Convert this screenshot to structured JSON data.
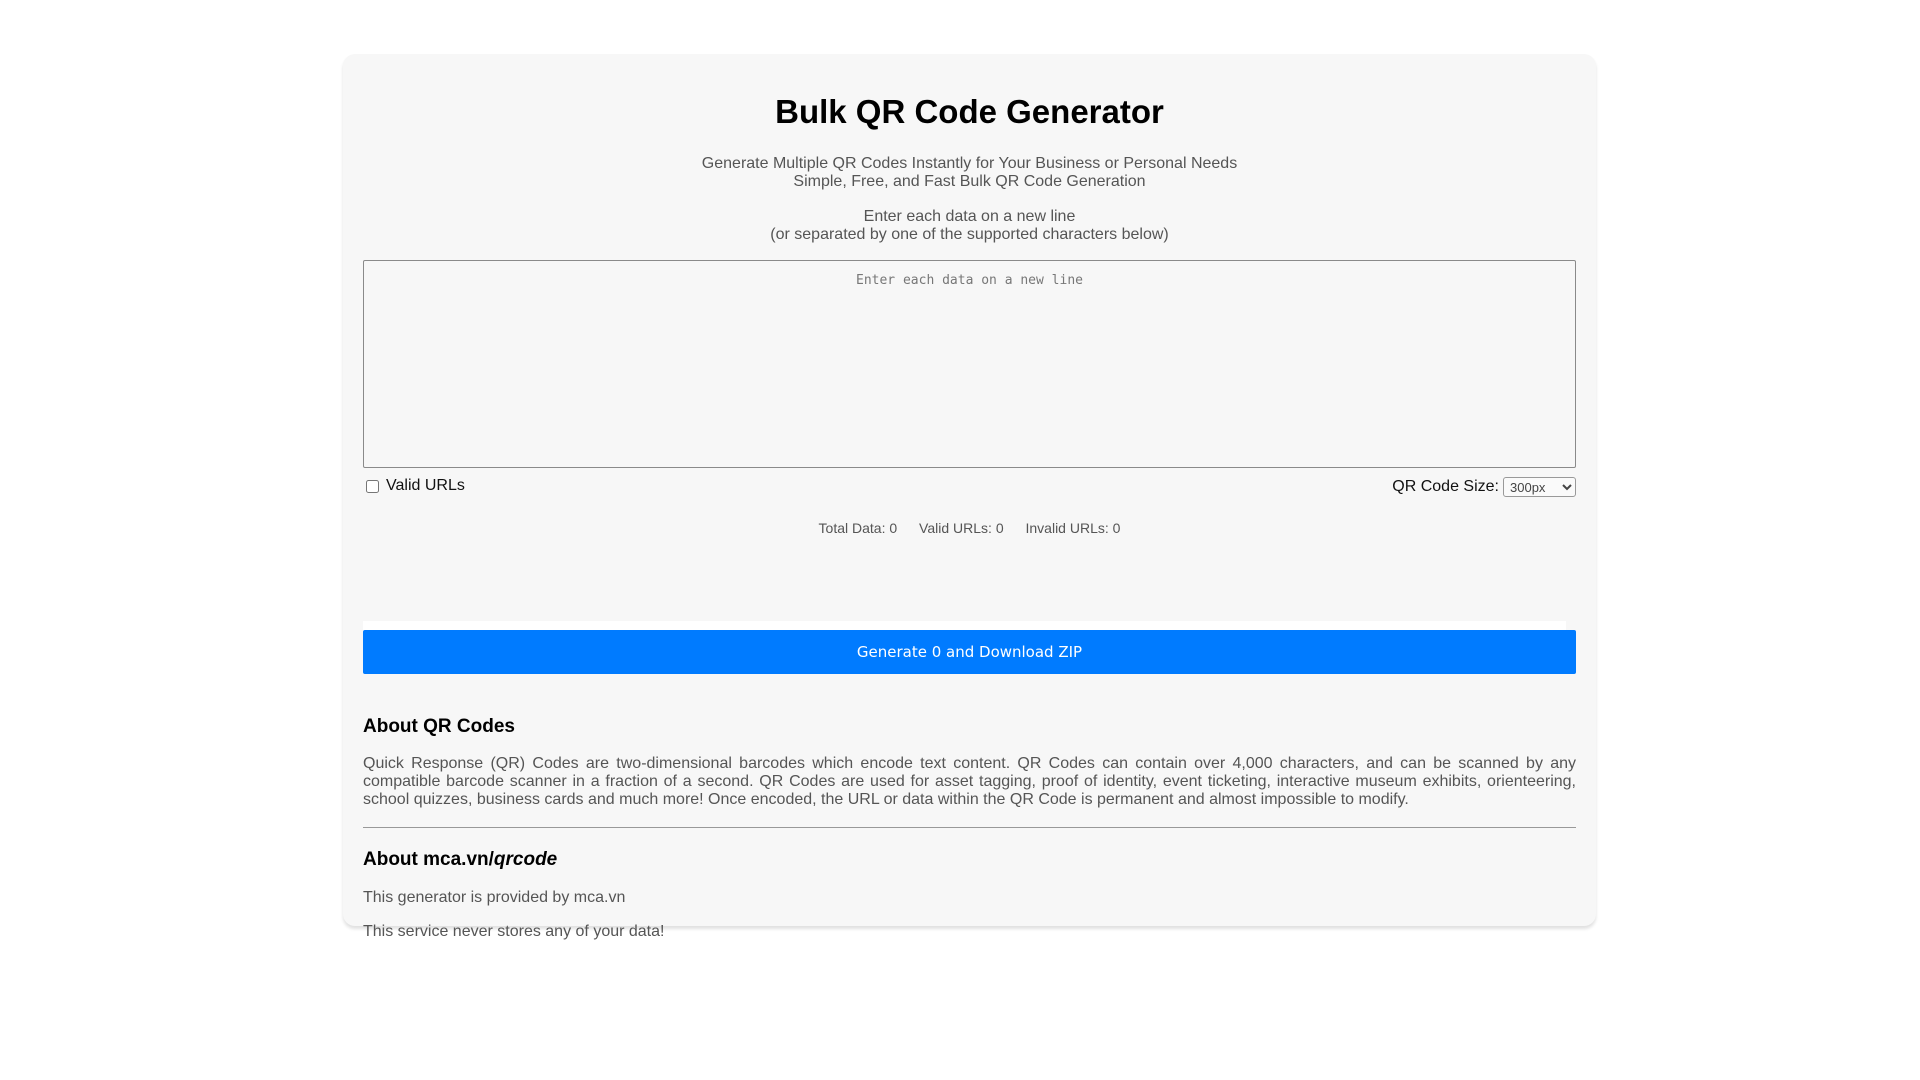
{
  "header": {
    "title": "Bulk QR Code Generator",
    "subtitle_line1": "Generate Multiple QR Codes Instantly for Your Business or Personal Needs",
    "subtitle_line2": "Simple, Free, and Fast Bulk QR Code Generation",
    "instruction_line1": "Enter each data on a new line",
    "instruction_line2": "(or separated by one of the supported characters below)"
  },
  "input": {
    "placeholder": "Enter each data on a new line",
    "value": ""
  },
  "options": {
    "valid_urls_label": "Valid URLs",
    "valid_urls_checked": false,
    "size_label": "QR Code Size:",
    "size_selected": "300px"
  },
  "stats": {
    "total_data": "Total Data: 0",
    "valid_urls": "Valid URLs: 0",
    "invalid_urls": "Invalid URLs: 0"
  },
  "progress": {
    "fraction": 0
  },
  "generate_button": {
    "label": "Generate 0 and Download ZIP",
    "color": "#007bff"
  },
  "about_qr": {
    "heading": "About QR Codes",
    "text": "Quick Response (QR) Codes are two-dimensional barcodes which encode text content. QR Codes can contain over 4,000 characters, and can be scanned by any compatible barcode scanner in a fraction of a second. QR Codes are used for asset tagging, proof of identity, event ticketing, interactive museum exhibits, orienteering, school quizzes, business cards and much more! Once encoded, the URL or data within the QR Code is permanent and almost impossible to modify."
  },
  "about_site": {
    "heading_prefix": "About mca.vn/",
    "heading_italic": "qrcode",
    "provider_text": "This generator is provided by mca.vn",
    "privacy_text": "This service never stores any of your data!"
  }
}
